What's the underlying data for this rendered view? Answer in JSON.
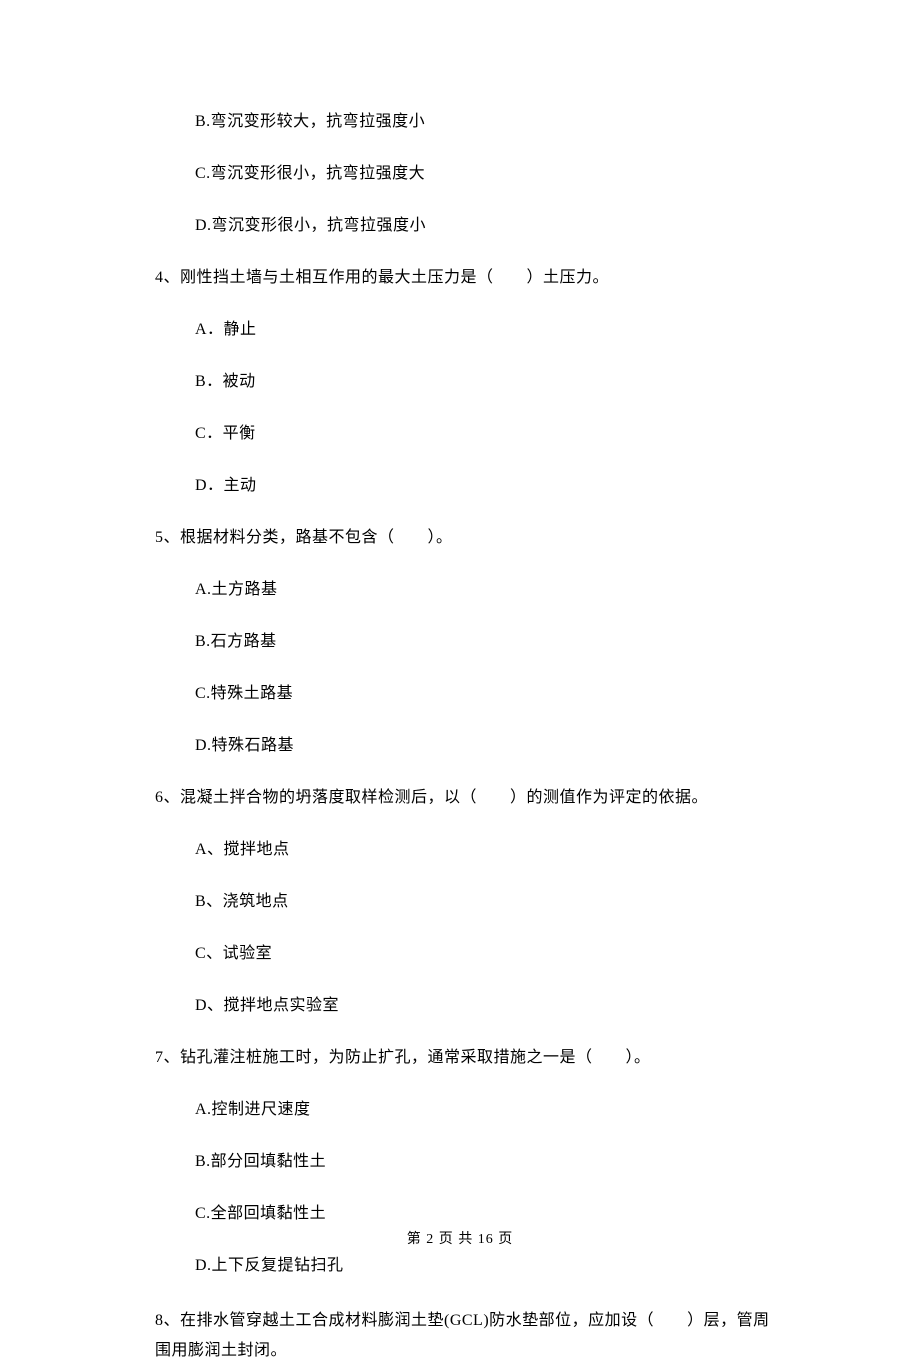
{
  "options_prev": {
    "b": "B.弯沉变形较大，抗弯拉强度小",
    "c": "C.弯沉变形很小，抗弯拉强度大",
    "d": "D.弯沉变形很小，抗弯拉强度小"
  },
  "q4": {
    "stem": "4、刚性挡土墙与土相互作用的最大土压力是（　　）土压力。",
    "a": "A．静止",
    "b": "B．被动",
    "c": "C．平衡",
    "d": "D．主动"
  },
  "q5": {
    "stem": "5、根据材料分类，路基不包含（　　）。",
    "a": "A.土方路基",
    "b": "B.石方路基",
    "c": "C.特殊土路基",
    "d": "D.特殊石路基"
  },
  "q6": {
    "stem": "6、混凝土拌合物的坍落度取样检测后，以（　　）的测值作为评定的依据。",
    "a": "A、搅拌地点",
    "b": "B、浇筑地点",
    "c": "C、试验室",
    "d": "D、搅拌地点实验室"
  },
  "q7": {
    "stem": "7、钻孔灌注桩施工时，为防止扩孔，通常采取措施之一是（　　）。",
    "a": "A.控制进尺速度",
    "b": "B.部分回填黏性土",
    "c": "C.全部回填黏性土",
    "d": "D.上下反复提钻扫孔"
  },
  "q8": {
    "stem": "8、在排水管穿越土工合成材料膨润土垫(GCL)防水垫部位，应加设（　　）层，管周围用膨润土封闭。"
  },
  "footer": "第 2 页 共 16 页"
}
